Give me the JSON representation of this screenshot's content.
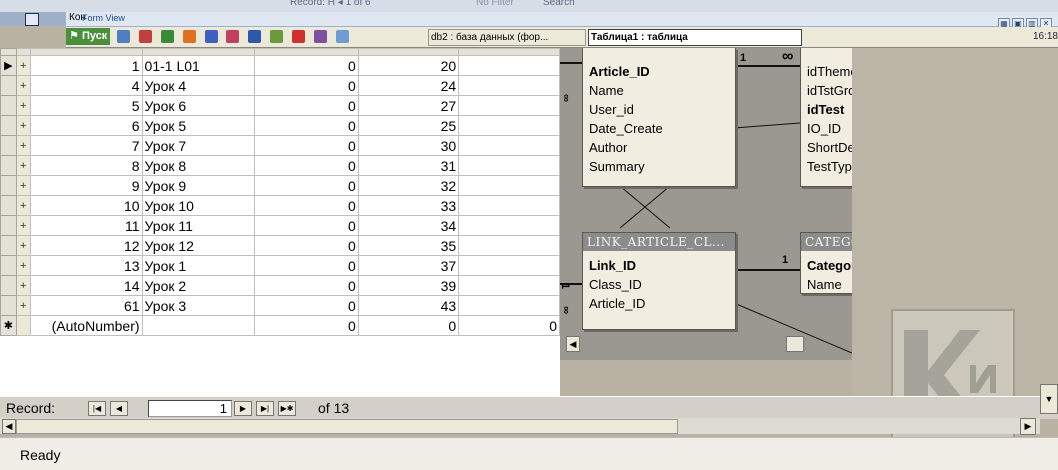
{
  "top_strip": {
    "record_text": "Record: H  ◂  1 of 6",
    "nofilter": "No Filter",
    "search": "Search"
  },
  "form_view": {
    "kon": "Кон",
    "title": "Form View"
  },
  "taskbar": {
    "start": "Пуск",
    "tasks": [
      "db2 : база данных (фор...",
      "Таблица1 : таблица"
    ],
    "clock": "16:18"
  },
  "datasheet": {
    "rows": [
      {
        "c1": "1",
        "c2": "01-1 L01",
        "c3": "0",
        "c4": "20"
      },
      {
        "c1": "4",
        "c2": "Урок 4",
        "c3": "0",
        "c4": "24"
      },
      {
        "c1": "5",
        "c2": "Урок 6",
        "c3": "0",
        "c4": "27"
      },
      {
        "c1": "6",
        "c2": "Урок 5",
        "c3": "0",
        "c4": "25"
      },
      {
        "c1": "7",
        "c2": "Урок 7",
        "c3": "0",
        "c4": "30"
      },
      {
        "c1": "8",
        "c2": "Урок 8",
        "c3": "0",
        "c4": "31"
      },
      {
        "c1": "9",
        "c2": "Урок 9",
        "c3": "0",
        "c4": "32"
      },
      {
        "c1": "10",
        "c2": "Урок 10",
        "c3": "0",
        "c4": "33"
      },
      {
        "c1": "11",
        "c2": "Урок 11",
        "c3": "0",
        "c4": "34"
      },
      {
        "c1": "12",
        "c2": "Урок 12",
        "c3": "0",
        "c4": "35"
      },
      {
        "c1": "13",
        "c2": "Урок 1",
        "c3": "0",
        "c4": "37"
      },
      {
        "c1": "14",
        "c2": "Урок 2",
        "c3": "0",
        "c4": "39"
      },
      {
        "c1": "61",
        "c2": "Урок 3",
        "c3": "0",
        "c4": "43"
      }
    ],
    "new_row": {
      "c1": "(AutoNumber)",
      "c3": "0",
      "c4": "0",
      "c5": "0"
    }
  },
  "diagram": {
    "article_fields": [
      "Article_ID",
      "Name",
      "User_id",
      "Date_Create",
      "Author",
      "Summary"
    ],
    "test_fields": [
      "idTheme",
      "idTstGroup",
      "idTest",
      "IO_ID",
      "ShortDescr",
      "TestType"
    ],
    "link_title": "LINK_ARTICLE_CL...",
    "link_fields": [
      "Link_ID",
      "Class_ID",
      "Article_ID"
    ],
    "category_title": "CATEGORY",
    "category_fields": [
      "Category_id",
      "Name"
    ],
    "rel_labels": [
      "1",
      "∞",
      "1",
      "1",
      "∞",
      "∞"
    ]
  },
  "record_nav": {
    "label": "Record:",
    "current": "1",
    "of": "of 13"
  },
  "status": {
    "text": "Ready"
  }
}
